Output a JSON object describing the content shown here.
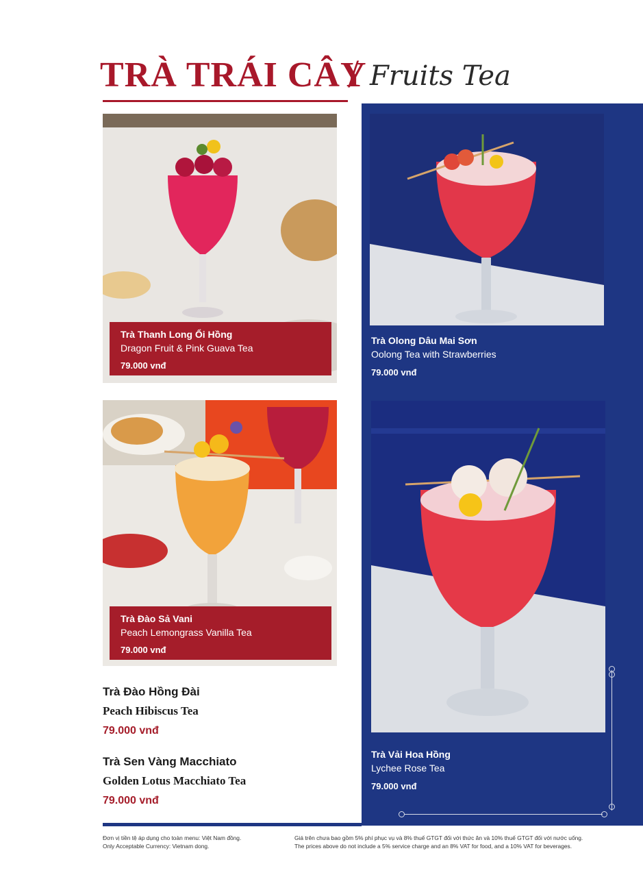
{
  "header": {
    "title_vn": "TRÀ TRÁI CÂY",
    "slash": "/",
    "title_en": "Fruits Tea"
  },
  "items": [
    {
      "name_vn": "Trà Thanh Long Ổi Hồng",
      "name_en": "Dragon Fruit & Pink Guava Tea",
      "price": "79.000 vnđ"
    },
    {
      "name_vn": "Trà Olong Dâu Mai Sơn",
      "name_en": "Oolong Tea with Strawberries",
      "price": "79.000 vnđ"
    },
    {
      "name_vn": "Trà Đào Sả Vani",
      "name_en": "Peach Lemongrass Vanilla Tea",
      "price": "79.000 vnđ"
    },
    {
      "name_vn": "Trà Vải Hoa Hồng",
      "name_en": "Lychee Rose Tea",
      "price": "79.000 vnđ"
    },
    {
      "name_vn": "Trà Đào Hồng Đài",
      "name_en": "Peach Hibiscus Tea",
      "price": "79.000 vnđ"
    },
    {
      "name_vn": "Trà Sen Vàng Macchiato",
      "name_en": "Golden Lotus Macchiato Tea",
      "price": "79.000 vnđ"
    }
  ],
  "footer": {
    "currency_vn": "Đơn vị tiền tệ áp dụng cho toàn menu: Việt Nam đồng.",
    "currency_en": "Only Acceptable Currency: Vietnam dong.",
    "tax_vn": "Giá trên chưa bao gồm 5% phí phục vụ và 8% thuế GTGT đối với thức ăn và 10% thuế GTGT đối với nước uống.",
    "tax_en": "The prices above do not include a 5% service charge and an 8% VAT for food, and a 10% VAT for beverages."
  },
  "colors": {
    "brand_red": "#a8182a",
    "panel_blue": "#1e3683",
    "price_red": "#a51d2a"
  },
  "photos": [
    {
      "depicts": "dragon-fruit-pink-guava-tea-glass"
    },
    {
      "depicts": "oolong-strawberry-tea-glass"
    },
    {
      "depicts": "peach-lemongrass-vanilla-tea-glass"
    },
    {
      "depicts": "lychee-rose-tea-glass"
    }
  ]
}
